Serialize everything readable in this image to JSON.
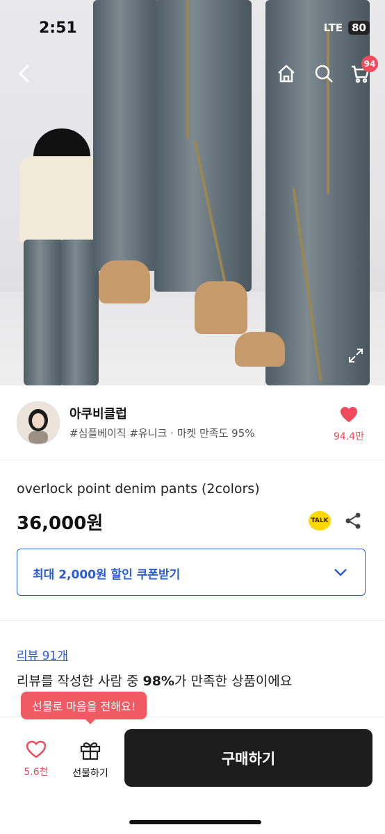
{
  "status_bar": {
    "time": "2:51",
    "network": "LTE",
    "battery": "80"
  },
  "header": {
    "cart_count": "94"
  },
  "shop": {
    "name": "아쿠비클럽",
    "tags": "#심플베이직 #유니크 · 마켓 만족도 95%",
    "like_count": "94.4만"
  },
  "product": {
    "title": "overlock point denim pants (2colors)",
    "price": "36,000원",
    "talk_label": "TALK"
  },
  "coupon": {
    "label": "최대 2,000원 할인 쿠폰받기"
  },
  "review": {
    "link": "리뷰 91개",
    "summary_prefix": "리뷰를 작성한 사람 중 ",
    "summary_percent": "98%",
    "summary_suffix": "가 만족한 상품이에요"
  },
  "bottom_bar": {
    "tooltip": "선물로 마음을 전해요!",
    "like_count": "5.6천",
    "gift_label": "선물하기",
    "buy_label": "구매하기"
  },
  "colors": {
    "accent_blue": "#2a5bd7",
    "accent_red": "#ef4b5c",
    "buy_button": "#1d1d1d"
  }
}
